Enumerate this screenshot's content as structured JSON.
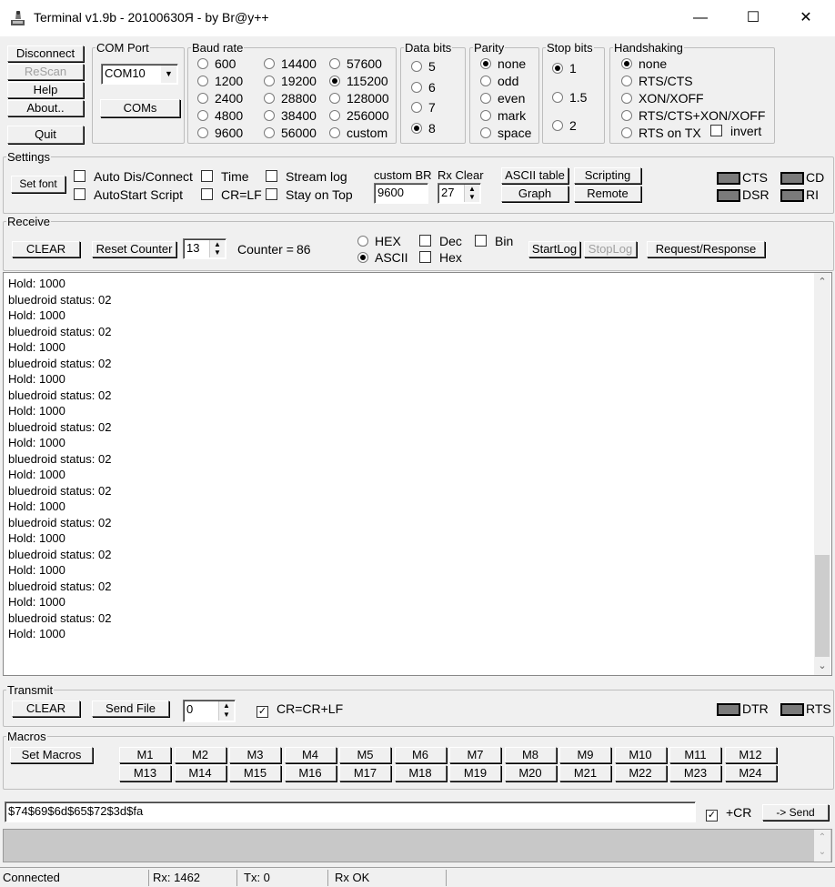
{
  "window": {
    "title": "Terminal v1.9b - 20100630Я - by Br@y++",
    "minimize": "—",
    "maximize": "☐",
    "close": "✕"
  },
  "left_buttons": {
    "disconnect": "Disconnect",
    "rescan": "ReScan",
    "help": "Help",
    "about": "About..",
    "quit": "Quit"
  },
  "com_port": {
    "legend": "COM Port",
    "value": "COM10",
    "coms_button": "COMs"
  },
  "baud_rate": {
    "legend": "Baud rate",
    "options": [
      "600",
      "1200",
      "2400",
      "4800",
      "9600",
      "14400",
      "19200",
      "28800",
      "38400",
      "56000",
      "57600",
      "115200",
      "128000",
      "256000",
      "custom"
    ],
    "selected": "115200"
  },
  "data_bits": {
    "legend": "Data bits",
    "options": [
      "5",
      "6",
      "7",
      "8"
    ],
    "selected": "8"
  },
  "parity": {
    "legend": "Parity",
    "options": [
      "none",
      "odd",
      "even",
      "mark",
      "space"
    ],
    "selected": "none"
  },
  "stop_bits": {
    "legend": "Stop bits",
    "options": [
      "1",
      "1.5",
      "2"
    ],
    "selected": "1"
  },
  "handshaking": {
    "legend": "Handshaking",
    "options": [
      "none",
      "RTS/CTS",
      "XON/XOFF",
      "RTS/CTS+XON/XOFF",
      "RTS on TX"
    ],
    "selected": "none",
    "invert_label": "invert"
  },
  "settings": {
    "legend": "Settings",
    "set_font": "Set font",
    "auto_dis_connect": "Auto Dis/Connect",
    "autostart_script": "AutoStart Script",
    "time": "Time",
    "crlf": "CR=LF",
    "stream_log": "Stream log",
    "stay_on_top": "Stay on Top",
    "custom_br_label": "custom BR",
    "custom_br_value": "9600",
    "rx_clear_label": "Rx Clear",
    "rx_clear_value": "27",
    "ascii_table": "ASCII table",
    "scripting": "Scripting",
    "graph": "Graph",
    "remote": "Remote",
    "leds": {
      "cts": "CTS",
      "cd": "CD",
      "dsr": "DSR",
      "ri": "RI"
    }
  },
  "receive": {
    "legend": "Receive",
    "clear": "CLEAR",
    "reset_counter": "Reset Counter",
    "counter_spin": "13",
    "counter_label": "Counter =",
    "counter_value": "86",
    "hex": "HEX",
    "ascii": "ASCII",
    "dec": "Dec",
    "hex_chk": "Hex",
    "bin": "Bin",
    "startlog": "StartLog",
    "stoplog": "StopLog",
    "request_response": "Request/Response",
    "lines": [
      "Hold: 1000",
      "bluedroid status: 02",
      "Hold: 1000",
      "bluedroid status: 02",
      "Hold: 1000",
      "bluedroid status: 02",
      "Hold: 1000",
      "bluedroid status: 02",
      "Hold: 1000",
      "bluedroid status: 02",
      "Hold: 1000",
      "bluedroid status: 02",
      "Hold: 1000",
      "bluedroid status: 02",
      "Hold: 1000",
      "bluedroid status: 02",
      "Hold: 1000",
      "bluedroid status: 02",
      "Hold: 1000",
      "bluedroid status: 02",
      "Hold: 1000",
      "bluedroid status: 02",
      "Hold: 1000"
    ]
  },
  "transmit": {
    "legend": "Transmit",
    "clear": "CLEAR",
    "send_file": "Send File",
    "spin_value": "0",
    "cr_crlf": "CR=CR+LF",
    "dtr": "DTR",
    "rts": "RTS"
  },
  "macros": {
    "legend": "Macros",
    "set_macros": "Set Macros",
    "buttons": [
      "M1",
      "M2",
      "M3",
      "M4",
      "M5",
      "M6",
      "M7",
      "M8",
      "M9",
      "M10",
      "M11",
      "M12",
      "M13",
      "M14",
      "M15",
      "M16",
      "M17",
      "M18",
      "M19",
      "M20",
      "M21",
      "M22",
      "M23",
      "M24"
    ]
  },
  "send": {
    "input": "$74$69$6d$65$72$3d$fa",
    "cr_label": "+CR",
    "send_button": "-> Send"
  },
  "statusbar": {
    "connected": "Connected",
    "rx": "Rx: 1462",
    "tx": "Tx: 0",
    "rx_ok": "Rx OK"
  }
}
